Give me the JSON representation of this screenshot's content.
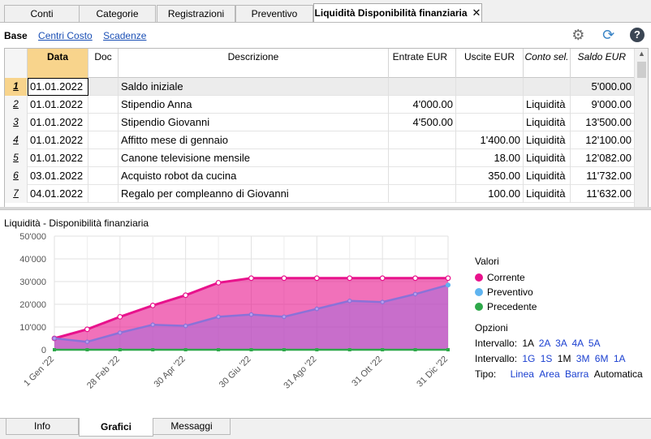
{
  "top_tabs": [
    "Conti",
    "Categorie",
    "Registrazioni",
    "Preventivo",
    "Liquidità Disponibilità finanziaria"
  ],
  "close_glyph": "✕",
  "views": {
    "active": "Base",
    "links": [
      "Centri Costo",
      "Scadenze"
    ]
  },
  "toolbar": {
    "settings_icon": "gear-icon",
    "refresh_icon": "refresh-icon",
    "help_icon": "help-icon",
    "help_label": "?"
  },
  "table": {
    "columns": [
      "Data",
      "Doc",
      "Descrizione",
      "Entrate EUR",
      "Uscite EUR",
      "Conto sel.",
      "Saldo EUR"
    ],
    "rows": [
      {
        "n": "1",
        "date": "01.01.2022",
        "doc": "",
        "desc": "Saldo iniziale",
        "in": "",
        "out": "",
        "acc": "",
        "bal": "5'000.00"
      },
      {
        "n": "2",
        "date": "01.01.2022",
        "doc": "",
        "desc": "Stipendio Anna",
        "in": "4'000.00",
        "out": "",
        "acc": "Liquidità",
        "bal": "9'000.00"
      },
      {
        "n": "3",
        "date": "01.01.2022",
        "doc": "",
        "desc": "Stipendio Giovanni",
        "in": "4'500.00",
        "out": "",
        "acc": "Liquidità",
        "bal": "13'500.00"
      },
      {
        "n": "4",
        "date": "01.01.2022",
        "doc": "",
        "desc": "Affitto mese di gennaio",
        "in": "",
        "out": "1'400.00",
        "acc": "Liquidità",
        "bal": "12'100.00"
      },
      {
        "n": "5",
        "date": "01.01.2022",
        "doc": "",
        "desc": "Canone televisione mensile",
        "in": "",
        "out": "18.00",
        "acc": "Liquidità",
        "bal": "12'082.00"
      },
      {
        "n": "6",
        "date": "03.01.2022",
        "doc": "",
        "desc": "Acquisto robot da cucina",
        "in": "",
        "out": "350.00",
        "acc": "Liquidità",
        "bal": "11'732.00"
      },
      {
        "n": "7",
        "date": "04.01.2022",
        "doc": "",
        "desc": "Regalo per compleanno di Giovanni",
        "in": "",
        "out": "100.00",
        "acc": "Liquidità",
        "bal": "11'632.00"
      }
    ]
  },
  "chart_panel": {
    "title": "Liquidità - Disponibilità finanziaria",
    "legend": {
      "header": "Valori",
      "items": [
        {
          "label": "Corrente",
          "color": "#e8128c"
        },
        {
          "label": "Preventivo",
          "color": "#5fb4f0"
        },
        {
          "label": "Precedente",
          "color": "#2ea84a"
        }
      ],
      "options_header": "Opzioni",
      "interval_label": "Intervallo:",
      "interval1": [
        "1A",
        "2A",
        "3A",
        "4A",
        "5A"
      ],
      "interval2": [
        "1G",
        "1S",
        "1M",
        "3M",
        "6M",
        "1A"
      ],
      "interval2_current": "1M",
      "type_label": "Tipo:",
      "types": [
        "Linea",
        "Area",
        "Barra",
        "Automatica"
      ],
      "type_current": "Automatica"
    }
  },
  "chart_data": {
    "type": "area",
    "x_ticks": [
      "1 Gen '22",
      "28 Feb '22",
      "30 Apr '22",
      "30 Giu '22",
      "31 Ago '22",
      "31 Ott '22",
      "31 Dic '22"
    ],
    "y_ticks": [
      "50'000",
      "40'000",
      "30'000",
      "20'000",
      "10'000",
      "0"
    ],
    "ylim": [
      0,
      50000
    ],
    "points_count": 13,
    "series": [
      {
        "name": "Corrente",
        "color": "#e8128c",
        "fill": "#e8128c",
        "values": [
          5000,
          9000,
          14500,
          19500,
          24000,
          29500,
          31500,
          31500,
          31500,
          31500,
          31500,
          31500,
          31500
        ]
      },
      {
        "name": "Preventivo",
        "color": "#8a72d8",
        "fill": "#a66cd9",
        "values": [
          5000,
          3500,
          7500,
          11000,
          10500,
          14500,
          15500,
          14500,
          18000,
          21500,
          21000,
          24500,
          28500
        ]
      },
      {
        "name": "Precedente",
        "color": "#2ea84a",
        "values": [
          0,
          0,
          0,
          0,
          0,
          0,
          0,
          0,
          0,
          0,
          0,
          0,
          0
        ]
      }
    ]
  },
  "bottom_tabs": {
    "items": [
      "Info",
      "Grafici",
      "Messaggi"
    ],
    "active": "Grafici"
  }
}
